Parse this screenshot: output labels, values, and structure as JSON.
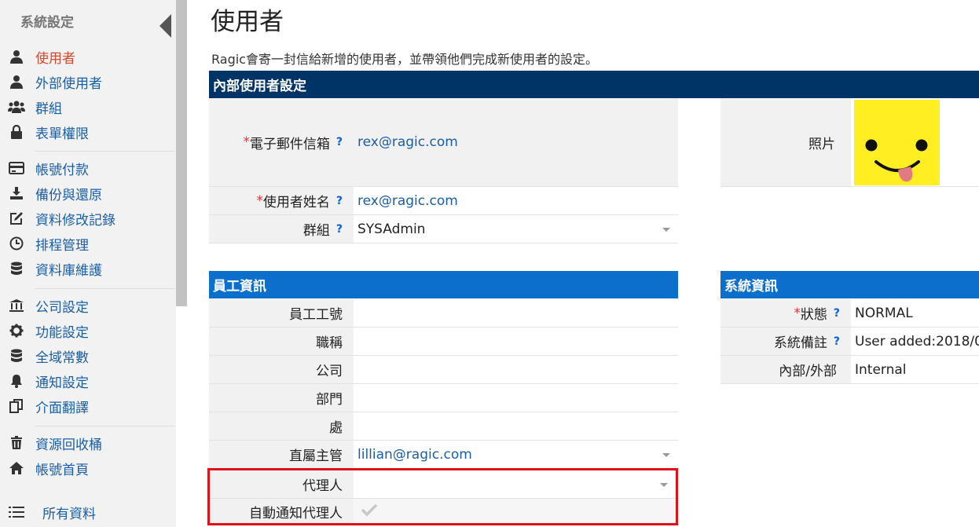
{
  "sidebar": {
    "title": "系統設定",
    "items": [
      {
        "label": "使用者",
        "icon": "user-icon"
      },
      {
        "label": "外部使用者",
        "icon": "user-icon"
      },
      {
        "label": "群組",
        "icon": "users-icon"
      },
      {
        "label": "表單權限",
        "icon": "lock-icon"
      },
      {
        "label": "帳號付款",
        "icon": "credit-card-icon"
      },
      {
        "label": "備份與還原",
        "icon": "download-icon"
      },
      {
        "label": "資料修改記錄",
        "icon": "edit-icon"
      },
      {
        "label": "排程管理",
        "icon": "clock-icon"
      },
      {
        "label": "資料庫維護",
        "icon": "database-icon"
      },
      {
        "label": "公司設定",
        "icon": "bank-icon"
      },
      {
        "label": "功能設定",
        "icon": "gear-icon"
      },
      {
        "label": "全域常數",
        "icon": "database-icon"
      },
      {
        "label": "通知設定",
        "icon": "bell-icon"
      },
      {
        "label": "介面翻譯",
        "icon": "copy-icon"
      },
      {
        "label": "資源回收桶",
        "icon": "trash-icon"
      },
      {
        "label": "帳號首頁",
        "icon": "home-icon"
      },
      {
        "label": "所有資料",
        "icon": "list-icon"
      }
    ]
  },
  "page": {
    "title": "使用者",
    "description": "Ragic會寄一封信給新增的使用者，並帶領他們完成新使用者的設定。"
  },
  "internal": {
    "header": "內部使用者設定",
    "email_label": "電子郵件信箱",
    "email_value": "rex@ragic.com",
    "name_label": "使用者姓名",
    "name_value": "rex@ragic.com",
    "group_label": "群組",
    "group_value": "SYSAdmin",
    "photo_label": "照片"
  },
  "employee": {
    "header": "員工資訊",
    "fields": [
      {
        "label": "員工工號",
        "value": ""
      },
      {
        "label": "職稱",
        "value": ""
      },
      {
        "label": "公司",
        "value": ""
      },
      {
        "label": "部門",
        "value": ""
      },
      {
        "label": "處",
        "value": ""
      },
      {
        "label": "直屬主管",
        "value": "lillian@ragic.com"
      },
      {
        "label": "代理人",
        "value": ""
      },
      {
        "label": "自動通知代理人",
        "value": ""
      }
    ]
  },
  "system": {
    "header": "系統資訊",
    "status_label": "狀態",
    "status_value": "NORMAL",
    "note_label": "系統備註",
    "note_value": "User added:2018/0",
    "type_label": "內部/外部",
    "type_value": "Internal"
  },
  "help_mark": "?",
  "required_mark": "*",
  "colors": {
    "header_dark": "#003366",
    "header_blue": "#0b6fcb",
    "active": "#d24a2e",
    "link": "#1a5ea6",
    "highlight": "#e0101a"
  }
}
